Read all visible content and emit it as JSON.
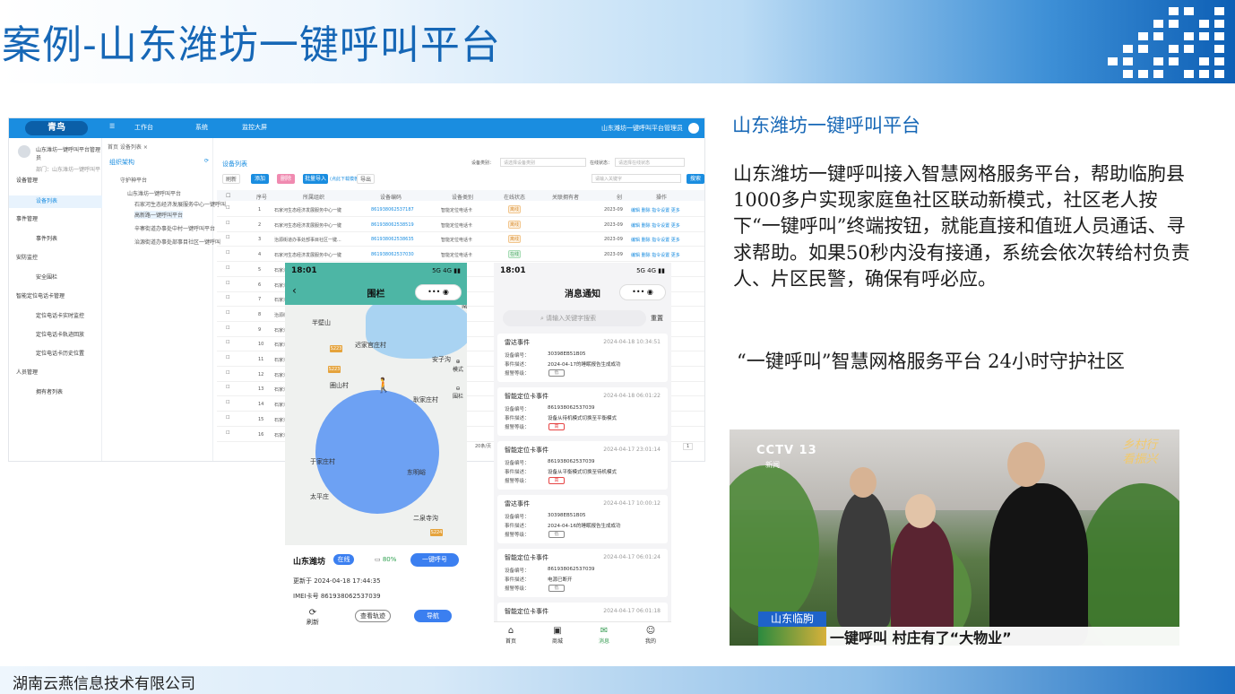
{
  "slide": {
    "title": "案例-山东潍坊一键呼叫平台",
    "company": "湖南云燕信息技术有限公司",
    "subtitle": "山东潍坊一键呼叫平台",
    "paragraph": "山东潍坊一键呼叫接入智慧网格服务平台，帮助临朐县1000多户实现家庭鱼社区联动新模式，社区老人按下“一键呼叫”终端按钮，就能直接和值班人员通话、寻求帮助。如果50秒内没有接通，系统会依次转给村负责人、片区民警，确保有呼必应。",
    "slogan": "“一键呼叫”智慧网格服务平台 24小时守护社区"
  },
  "admin": {
    "logo": "青鸟",
    "nav": [
      "工作台",
      "系统",
      "监控大屏"
    ],
    "user": "山东潍坊一键呼叫平台管理员",
    "side_user": "山东潍坊一键呼叫平台管理员",
    "side_sub": "部门：山东潍坊一键呼叫平",
    "menu": [
      {
        "label": "设备管理",
        "type": "group"
      },
      {
        "label": "设备列表",
        "type": "active"
      },
      {
        "label": "事件管理",
        "type": "group"
      },
      {
        "label": "事件列表",
        "type": "sub"
      },
      {
        "label": "安防监控",
        "type": "group"
      },
      {
        "label": "安全围栏",
        "type": "sub"
      },
      {
        "label": "智能定位电话卡管理",
        "type": "group"
      },
      {
        "label": "定位电话卡实时监控",
        "type": "sub"
      },
      {
        "label": "定位电话卡轨迹回放",
        "type": "sub"
      },
      {
        "label": "定位电话卡历史位置",
        "type": "sub"
      },
      {
        "label": "人员管理",
        "type": "group"
      },
      {
        "label": "拥有者列表",
        "type": "sub"
      }
    ],
    "tabs": "首页   设备列表 ×",
    "tree_title": "组织架构",
    "tree": [
      "守护神平台",
      "山东潍坊一键呼叫平台",
      "石家河生态经济发展服务中心一键呼叫",
      "高新路一键呼叫平台",
      "辛寨街道办事处中村一键呼叫平台",
      "治源街道办事处部事目社区一键呼叫"
    ],
    "table_title": "设备列表",
    "filter_type": "设备类别：",
    "filter_type_ph": "请选择设备类别",
    "filter_status": "在线状态：",
    "filter_status_ph": "请选择在线状态",
    "search_ph": "请输入关键字",
    "search_btn": "搜索",
    "buttons": [
      "刷新",
      "添加",
      "删除",
      "批量导入",
      "导出"
    ],
    "template_link": "(点此下载模板)",
    "columns": [
      "序号",
      "所属组织",
      "设备编码",
      "设备类别",
      "在线状态",
      "关联拥有者",
      "创",
      "操作"
    ],
    "rows": [
      {
        "no": "1",
        "org": "石家河生态经济发展服务中心一键",
        "code": "861938062537187",
        "type": "智能定位电话卡",
        "status": "离线",
        "date": "2023-09",
        "ops": "编辑  删除  指令设置  更多"
      },
      {
        "no": "2",
        "org": "石家河生态经济发展服务中心一键",
        "code": "861938062538519",
        "type": "智能定位电话卡",
        "status": "离线",
        "date": "2023-09",
        "ops": "编辑  删除  指令设置  更多"
      },
      {
        "no": "3",
        "org": "治源街道办事处部事目社区一键...",
        "code": "861938062538635",
        "type": "智能定位电话卡",
        "status": "离线",
        "date": "2023-09",
        "ops": "编辑  删除  指令设置  更多"
      },
      {
        "no": "4",
        "org": "石家河生态经济发展服务中心一键",
        "code": "861938062537030",
        "type": "智能定位电话卡",
        "status": "在线",
        "date": "2023-09",
        "ops": "编辑  删除  指令设置  更多"
      },
      {
        "no": "5",
        "org": "石家河生态",
        "code": "",
        "type": "",
        "status": "",
        "date": "",
        "ops": ""
      },
      {
        "no": "6",
        "org": "石家河生态",
        "code": "",
        "type": "",
        "status": "",
        "date": "",
        "ops": ""
      },
      {
        "no": "7",
        "org": "石家河生态",
        "code": "",
        "type": "",
        "status": "",
        "date": "",
        "ops": ""
      },
      {
        "no": "8",
        "org": "治源街道",
        "code": "",
        "type": "",
        "status": "",
        "date": "",
        "ops": ""
      },
      {
        "no": "9",
        "org": "石家河生态",
        "code": "",
        "type": "",
        "status": "",
        "date": "",
        "ops": ""
      },
      {
        "no": "10",
        "org": "石家河生态",
        "code": "",
        "type": "",
        "status": "",
        "date": "",
        "ops": ""
      },
      {
        "no": "11",
        "org": "石家河生态",
        "code": "",
        "type": "",
        "status": "",
        "date": "",
        "ops": ""
      },
      {
        "no": "12",
        "org": "石家河生态",
        "code": "",
        "type": "",
        "status": "",
        "date": "",
        "ops": ""
      },
      {
        "no": "13",
        "org": "石家河生态",
        "code": "",
        "type": "",
        "status": "",
        "date": "",
        "ops": ""
      },
      {
        "no": "14",
        "org": "石家河生态",
        "code": "",
        "type": "",
        "status": "",
        "date": "",
        "ops": ""
      },
      {
        "no": "15",
        "org": "石家河生态",
        "code": "",
        "type": "",
        "status": "",
        "date": "",
        "ops": ""
      },
      {
        "no": "16",
        "org": "石家河生态",
        "code": "",
        "type": "",
        "status": "",
        "date": "",
        "ops": ""
      }
    ],
    "pager_size": "20条/页",
    "pager_page": "1"
  },
  "phone_map": {
    "time": "18:01",
    "signal": "5G 4G ▮▮",
    "title": "围栏",
    "capsule": "••• ◉",
    "labels": [
      "半壁山",
      "迟家官庄村",
      "安子沟",
      "圈山村",
      "耿家庄村",
      "于家庄村",
      "东明峪",
      "太平庄",
      "二泉寺沟",
      "南嶂"
    ],
    "roads": [
      "S223",
      "S223",
      "S224"
    ],
    "tool_mode": "模式",
    "tool_fence": "围栏",
    "device_name": "山东潍坊",
    "online": "在线",
    "battery": "80%",
    "call": "一键呼号",
    "updated": "更新于 2024-04-18 17:44:35",
    "imei": "IMEI卡号 861938062537039",
    "refresh": "刷新",
    "track": "查看轨迹",
    "navigate": "导航"
  },
  "phone_msg": {
    "time": "18:01",
    "signal": "5G 4G ▮▮",
    "title": "消息通知",
    "capsule": "••• ◉",
    "search_ph": "请输入关键字搜索",
    "reset": "重置",
    "cards": [
      {
        "title": "雷达事件",
        "time": "2024-04-18 10:34:51",
        "l1": "设备编号：",
        "v1": "30398EB51B05",
        "l2": "事件描述：",
        "v2": "2024-04-17的睡眠报告生成成功",
        "l3": "报警等级：",
        "level": "低",
        "level_color": "#888888"
      },
      {
        "title": "智能定位卡事件",
        "time": "2024-04-18 06:01:22",
        "l1": "设备编号：",
        "v1": "861938062537039",
        "l2": "事件描述：",
        "v2": "设备从待机模式切换至平衡模式",
        "l3": "报警等级：",
        "level": "高",
        "level_color": "#e64545"
      },
      {
        "title": "智能定位卡事件",
        "time": "2024-04-17 23:01:14",
        "l1": "设备编号：",
        "v1": "861938062537039",
        "l2": "事件描述：",
        "v2": "设备从平衡模式切换至待机模式",
        "l3": "报警等级：",
        "level": "高",
        "level_color": "#e64545"
      },
      {
        "title": "雷达事件",
        "time": "2024-04-17 10:00:12",
        "l1": "设备编号：",
        "v1": "30398EB51B05",
        "l2": "事件描述：",
        "v2": "2024-04-16的睡眠报告生成成功",
        "l3": "报警等级：",
        "level": "低",
        "level_color": "#888888"
      },
      {
        "title": "智能定位卡事件",
        "time": "2024-04-17 06:01:24",
        "l1": "设备编号：",
        "v1": "861938062537039",
        "l2": "事件描述：",
        "v2": "电源已断开",
        "l3": "报警等级：",
        "level": "低",
        "level_color": "#888888"
      },
      {
        "title": "智能定位卡事件",
        "time": "2024-04-17 06:01:18",
        "l1": "",
        "v1": "",
        "l2": "",
        "v2": "",
        "l3": "",
        "level": "",
        "level_color": "#888888"
      }
    ],
    "tabs": [
      {
        "icon": "⌂",
        "label": "首页"
      },
      {
        "icon": "▣",
        "label": "商城"
      },
      {
        "icon": "✉",
        "label": "消息"
      },
      {
        "icon": "☺",
        "label": "我的"
      }
    ]
  },
  "photo": {
    "channel": "CCTV 13",
    "channel_sub": "新闻",
    "stamp": "乡村行 看振兴",
    "location": "山东临朐",
    "caption": "一键呼叫  村庄有了“大物业”"
  }
}
